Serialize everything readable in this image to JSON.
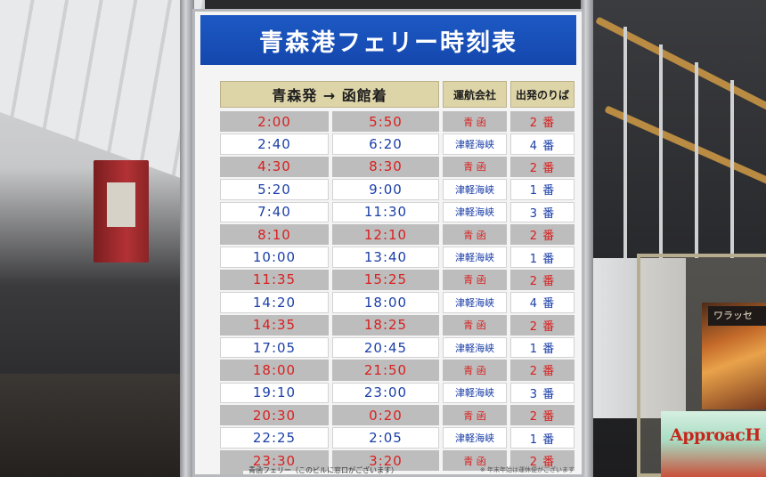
{
  "board": {
    "title": "青森港フェリー時刻表",
    "headers": {
      "route": "青森発 → 函館着",
      "operator": "運航会社",
      "berth": "出発のりば"
    },
    "rows": [
      {
        "dep": "2:00",
        "arr": "5:50",
        "operator": "青 函",
        "berth": "2 番",
        "type": "seikan"
      },
      {
        "dep": "2:40",
        "arr": "6:20",
        "operator": "津軽海峡",
        "berth": "4 番",
        "type": "tsugaru"
      },
      {
        "dep": "4:30",
        "arr": "8:30",
        "operator": "青 函",
        "berth": "2 番",
        "type": "seikan"
      },
      {
        "dep": "5:20",
        "arr": "9:00",
        "operator": "津軽海峡",
        "berth": "1 番",
        "type": "tsugaru"
      },
      {
        "dep": "7:40",
        "arr": "11:30",
        "operator": "津軽海峡",
        "berth": "3 番",
        "type": "tsugaru"
      },
      {
        "dep": "8:10",
        "arr": "12:10",
        "operator": "青 函",
        "berth": "2 番",
        "type": "seikan"
      },
      {
        "dep": "10:00",
        "arr": "13:40",
        "operator": "津軽海峡",
        "berth": "1 番",
        "type": "tsugaru"
      },
      {
        "dep": "11:35",
        "arr": "15:25",
        "operator": "青 函",
        "berth": "2 番",
        "type": "seikan"
      },
      {
        "dep": "14:20",
        "arr": "18:00",
        "operator": "津軽海峡",
        "berth": "4 番",
        "type": "tsugaru"
      },
      {
        "dep": "14:35",
        "arr": "18:25",
        "operator": "青 函",
        "berth": "2 番",
        "type": "seikan"
      },
      {
        "dep": "17:05",
        "arr": "20:45",
        "operator": "津軽海峡",
        "berth": "1 番",
        "type": "tsugaru"
      },
      {
        "dep": "18:00",
        "arr": "21:50",
        "operator": "青 函",
        "berth": "2 番",
        "type": "seikan"
      },
      {
        "dep": "19:10",
        "arr": "23:00",
        "operator": "津軽海峡",
        "berth": "3 番",
        "type": "tsugaru"
      },
      {
        "dep": "20:30",
        "arr": "0:20",
        "operator": "青 函",
        "berth": "2 番",
        "type": "seikan"
      },
      {
        "dep": "22:25",
        "arr": "2:05",
        "operator": "津軽海峡",
        "berth": "1 番",
        "type": "tsugaru"
      },
      {
        "dep": "23:30",
        "arr": "3:20",
        "operator": "青 函",
        "berth": "2 番",
        "type": "seikan"
      }
    ],
    "legend_left": "青函フェリー（このビルに窓口がございます）",
    "legend_right": "※ 年末年始は運休便がございます"
  },
  "scene": {
    "brochure_top": "ワラッセ",
    "brochure_bottom": "ApproacH"
  },
  "colors": {
    "header_blue": "#1447ad",
    "seikan_red": "#d8201f",
    "tsugaru_blue": "#1b3fa8",
    "seikan_row_gray": "#bdbdbd",
    "header_tan": "#ddd4a8"
  }
}
